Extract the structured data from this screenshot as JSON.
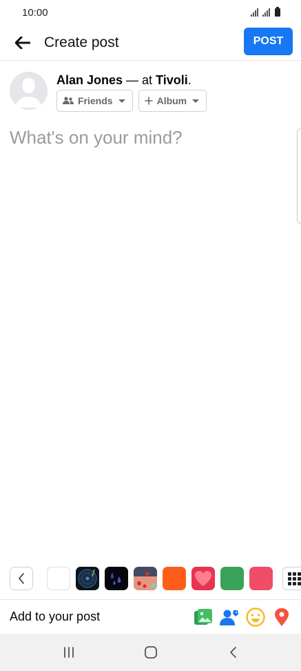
{
  "status_bar": {
    "time": "10:00"
  },
  "header": {
    "title": "Create post",
    "post_label": "POST",
    "back_icon": "arrow-left-icon"
  },
  "user": {
    "name": "Alan Jones",
    "separator": "— at",
    "place": "Tivoli",
    "period": ".",
    "audience_label": "Friends",
    "album_label": "Album"
  },
  "composer": {
    "placeholder": "What's on your mind?"
  },
  "background_picker": {
    "swatches": [
      {
        "name": "white",
        "color": "#ffffff"
      },
      {
        "name": "dark-record",
        "color": "#0b1420"
      },
      {
        "name": "dark-rain",
        "color": "#05070d"
      },
      {
        "name": "pattern-pink",
        "color": "#d98f7e"
      },
      {
        "name": "orange",
        "color": "#ff5e1a"
      },
      {
        "name": "heart-red",
        "color": "#e8344f"
      },
      {
        "name": "green",
        "color": "#3aa35a"
      },
      {
        "name": "coral",
        "color": "#ef4d67"
      }
    ]
  },
  "add_bar": {
    "label": "Add to your post",
    "icons": [
      "photo-icon",
      "tag-people-icon",
      "feeling-icon",
      "location-icon"
    ]
  },
  "colors": {
    "accent": "#1877f2",
    "photo": "#45bd62",
    "tag": "#1877f2",
    "feeling": "#f7b928",
    "location": "#f5533d"
  }
}
